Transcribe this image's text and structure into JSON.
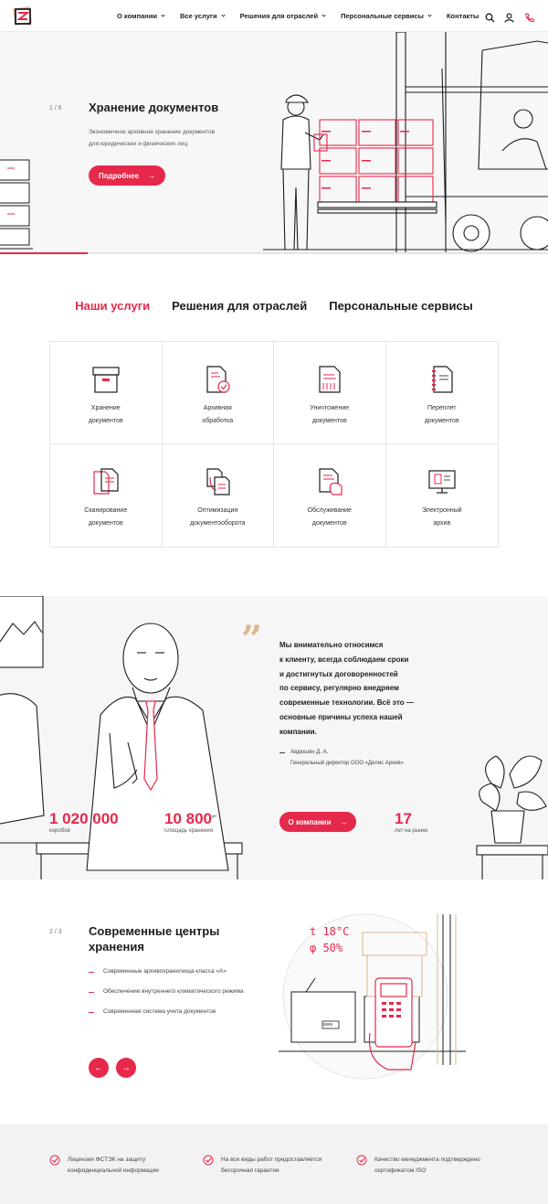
{
  "header": {
    "nav": [
      {
        "label": "О компании",
        "dropdown": true
      },
      {
        "label": "Все услуги",
        "dropdown": true
      },
      {
        "label": "Решения для отраслей",
        "dropdown": true
      },
      {
        "label": "Персональные сервисы",
        "dropdown": true
      },
      {
        "label": "Контакты",
        "dropdown": false
      }
    ],
    "icons": [
      "search-icon",
      "user-icon",
      "phone-icon"
    ]
  },
  "hero": {
    "counter": "1 / 6",
    "title": "Хранение документов",
    "description_line1": "Экономичное архивное хранение документов",
    "description_line2": "для юридических и физических лиц",
    "button": "Подробнее",
    "progress": 0.16
  },
  "services": {
    "tabs": [
      "Наши услуги",
      "Решения для отраслей",
      "Персональные сервисы"
    ],
    "active_tab": 0,
    "items": [
      {
        "line1": "Хранение",
        "line2": "документов",
        "icon": "archive-box-icon"
      },
      {
        "line1": "Архивная",
        "line2": "обработка",
        "icon": "document-check-icon"
      },
      {
        "line1": "Уничтожение",
        "line2": "документов",
        "icon": "shredder-icon"
      },
      {
        "line1": "Переплет",
        "line2": "документов",
        "icon": "binding-icon"
      },
      {
        "line1": "Сканирование",
        "line2": "документов",
        "icon": "scan-icon"
      },
      {
        "line1": "Оптимизация",
        "line2": "документооборота",
        "icon": "workflow-icon"
      },
      {
        "line1": "Обслуживание",
        "line2": "документов",
        "icon": "service-hand-icon"
      },
      {
        "line1": "Электронный",
        "line2": "архив",
        "icon": "monitor-icon"
      }
    ]
  },
  "about": {
    "quote_lines": [
      "Мы внимательно относимся",
      "к клиенту, всегда соблюдаем сроки",
      "и достигнутых договоренностей",
      "по сервису, регулярно внедряем",
      "современные технологии. Всё это —",
      "основные причины успеха нашей",
      "компании."
    ],
    "author_name": "Авдюшин Д. А.",
    "author_title": "Генеральный директор ООО «Делис Архив»",
    "stats": [
      {
        "value": "1 020 000",
        "label": "коробов",
        "unit": ""
      },
      {
        "value": "10 800",
        "label": "площадь хранения",
        "unit": "м²"
      },
      {
        "value": "17",
        "label": "лет на рынке",
        "unit": ""
      }
    ],
    "button": "О компании"
  },
  "centers": {
    "counter": "2 / 3",
    "title_line1": "Современные центры",
    "title_line2": "хранения",
    "bullets": [
      "Современные архивохранилища класса «А»",
      "Обеспечение внутреннего климатического режима",
      "Современная система учета документов"
    ],
    "illustration_texts": {
      "temp": "t 18°C",
      "humidity": "φ 50%",
      "box_label": "8869"
    }
  },
  "footer": {
    "items": [
      {
        "line1": "Лицензия ФСТЭК на защиту",
        "line2": "конфиденциальной информации"
      },
      {
        "line1": "На все виды работ предоставляется",
        "line2": "бессрочная гарантия"
      },
      {
        "line1": "Качество менеджмента подтверждено",
        "line2": "сертификатом ISO"
      }
    ]
  },
  "colors": {
    "accent": "#e6294b",
    "beige": "#d9b88f"
  }
}
